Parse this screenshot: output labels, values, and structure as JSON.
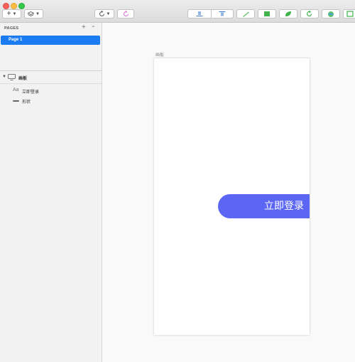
{
  "window": {
    "traffic_lights": [
      "close",
      "minimize",
      "zoom"
    ],
    "colors": {
      "close": "#fc605b",
      "minimize": "#fdbc40",
      "zoom": "#34c84a"
    }
  },
  "toolbar": {
    "buttons": [
      {
        "name": "insert-button",
        "icon": "plus-icon",
        "has_dropdown": true
      },
      {
        "name": "create-symbol-button",
        "icon": "layers-icon",
        "has_dropdown": true
      },
      {
        "name": "sync-button",
        "icon": "sync-icon",
        "has_dropdown": true
      },
      {
        "name": "sync-alt-button",
        "icon": "sync-pink-icon",
        "has_dropdown": false
      },
      {
        "name": "align-bottom-button",
        "icon": "align-bottom-icon"
      },
      {
        "name": "align-top-button",
        "icon": "align-top-icon"
      },
      {
        "name": "edit-button",
        "icon": "pencil-icon"
      },
      {
        "name": "transform-button",
        "icon": "transform-icon"
      },
      {
        "name": "shape-button",
        "icon": "leaf-icon"
      },
      {
        "name": "rotate-button",
        "icon": "rotate-icon"
      },
      {
        "name": "color-button",
        "icon": "globe-icon"
      },
      {
        "name": "frame-button",
        "icon": "frame-icon"
      }
    ],
    "accent": "#3eb34b"
  },
  "sidebar": {
    "pages_title": "PAGES",
    "pages": [
      {
        "label": "Page 1",
        "selected": true
      }
    ],
    "selection_color": "#1a7bf2",
    "artboard_group": {
      "label": "画板",
      "icon": "monitor-icon",
      "expanded": true
    },
    "layers": [
      {
        "label": "立即登录",
        "icon": "text-icon",
        "icon_text": "Aa"
      },
      {
        "label": "形状",
        "icon": "shape-icon"
      }
    ]
  },
  "canvas": {
    "artboard_label": "画板",
    "button": {
      "label": "立即登录",
      "color": "#5b66f4"
    }
  }
}
